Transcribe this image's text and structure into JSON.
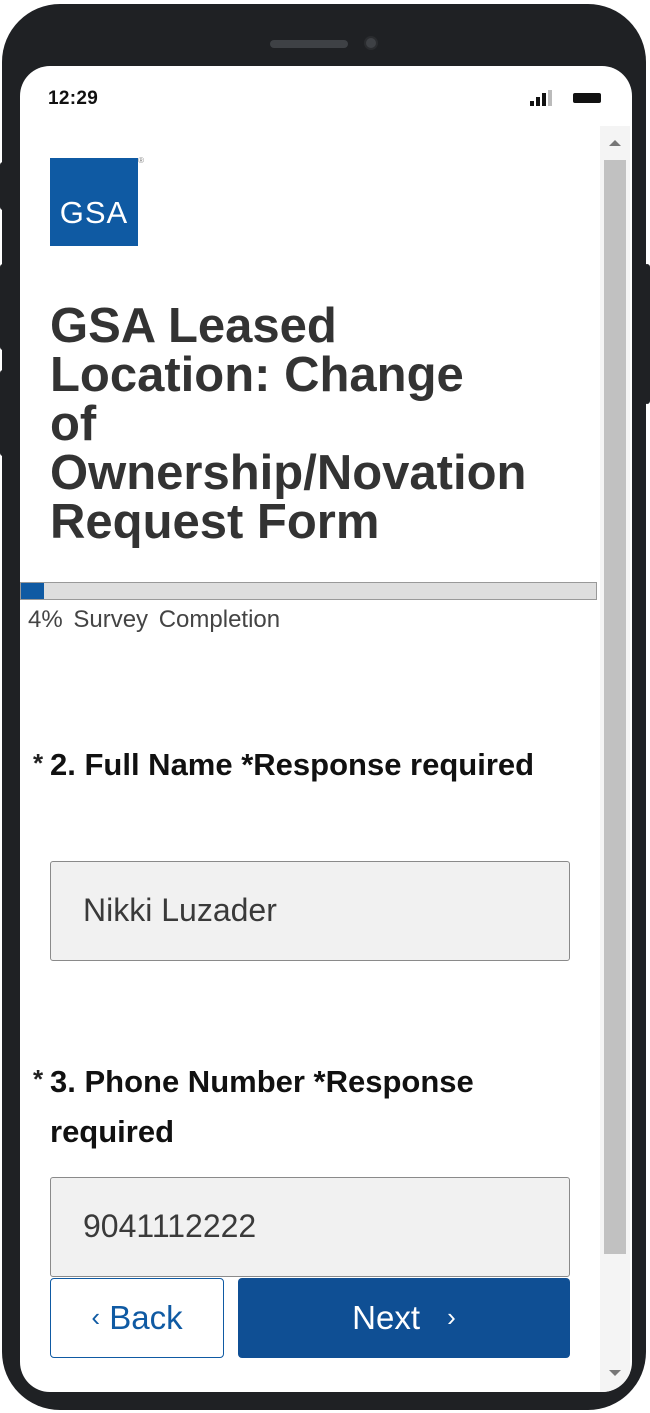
{
  "status_bar": {
    "time": "12:29"
  },
  "logo": {
    "text": "GSA",
    "mark": "®"
  },
  "form": {
    "title_lines": [
      "GSA Leased",
      "Location: Change",
      "of",
      "Ownership/Novation",
      "Request Form"
    ]
  },
  "progress": {
    "percent": 4,
    "label": "4%  Survey Completion"
  },
  "questions": [
    {
      "required_mark": "*",
      "label": "2. Full Name *Response required",
      "value": "Nikki Luzader"
    },
    {
      "required_mark": "*",
      "label": "3. Phone Number *Response required",
      "value": "9041112222"
    }
  ],
  "buttons": {
    "back": "Back",
    "back_icon": "‹",
    "next": "Next",
    "next_icon": "›"
  },
  "colors": {
    "accent": "#0f5aa3",
    "button_primary": "#0f4f94",
    "title": "#333333"
  },
  "icons": [
    "signal-icon",
    "battery-icon",
    "chevron-left-icon",
    "chevron-right-icon",
    "scroll-up-arrow-icon",
    "scroll-down-arrow-icon"
  ]
}
